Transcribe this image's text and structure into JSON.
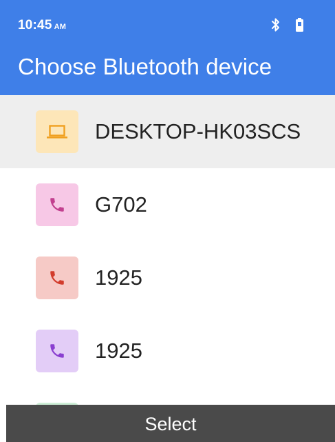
{
  "status_bar": {
    "time": "10:45",
    "ampm": "AM",
    "bluetooth_icon": "bluetooth-icon",
    "battery_icon": "battery-icon"
  },
  "header": {
    "title": "Choose Bluetooth device"
  },
  "devices": [
    {
      "name": "DESKTOP-HK03SCS",
      "icon": "laptop-icon",
      "icon_color": "#f0a020",
      "icon_bg": "#fde6b8",
      "selected": true
    },
    {
      "name": "G702",
      "icon": "phone-icon",
      "icon_color": "#c2408f",
      "icon_bg": "#f7c8e6",
      "selected": false
    },
    {
      "name": "1925",
      "icon": "phone-icon",
      "icon_color": "#d23c2c",
      "icon_bg": "#f6cac6",
      "selected": false
    },
    {
      "name": "1925",
      "icon": "phone-icon",
      "icon_color": "#8a3fd0",
      "icon_bg": "#e3cdf7",
      "selected": false
    }
  ],
  "partial_item": {
    "icon_bg": "#cdeed6"
  },
  "softkey": {
    "center_label": "Select"
  },
  "colors": {
    "header_bg": "#3f7fe8",
    "selected_bg": "#eeeeee",
    "softkey_bg": "#4a4a4a"
  }
}
